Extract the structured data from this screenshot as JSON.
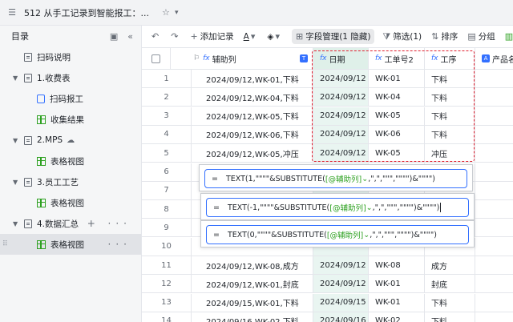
{
  "window": {
    "title": "512 从手工记录到智能报工：...",
    "menu_icon": "hamburger-icon",
    "star_icon": "star-icon"
  },
  "sidebar": {
    "header": "目录",
    "items": [
      {
        "label": "扫码说明",
        "icon": "doc-icon",
        "level": 0
      },
      {
        "label": "1.收费表",
        "icon": "doc-icon",
        "level": 0,
        "expandable": true
      },
      {
        "label": "扫码报工",
        "icon": "form-icon",
        "level": 1
      },
      {
        "label": "收集结果",
        "icon": "grid-icon",
        "level": 1
      },
      {
        "label": "2.MPS",
        "icon": "doc-icon",
        "level": 0,
        "expandable": true,
        "extra_icon": "cloud-icon"
      },
      {
        "label": "表格视图",
        "icon": "grid-icon",
        "level": 1
      },
      {
        "label": "3.员工工艺",
        "icon": "doc-icon",
        "level": 0,
        "expandable": true
      },
      {
        "label": "表格视图",
        "icon": "grid-icon",
        "level": 1
      },
      {
        "label": "4.数据汇总",
        "icon": "doc-icon",
        "level": 0,
        "expandable": true,
        "ops": "+ ···"
      },
      {
        "label": "表格视图",
        "icon": "grid-icon",
        "level": 1,
        "active": true,
        "ops": "···"
      }
    ]
  },
  "toolbar": {
    "undo": "↶",
    "redo": "↷",
    "add_record": "添加记录",
    "text_format": "A",
    "fill_color": "◈",
    "field_manage": "字段管理(1 隐藏)",
    "filter": "筛选(1)",
    "sort": "排序",
    "group": "分组"
  },
  "table": {
    "columns": {
      "aux": "辅助列",
      "date": "日期",
      "order_no": "工单号2",
      "process": "工序",
      "product": "产品名"
    },
    "rows": [
      {
        "n": "1",
        "aux": "2024/09/12,WK-01,下料",
        "date": "2024/09/12",
        "no": "WK-01",
        "proc": "下料"
      },
      {
        "n": "2",
        "aux": "2024/09/12,WK-04,下料",
        "date": "2024/09/12",
        "no": "WK-04",
        "proc": "下料"
      },
      {
        "n": "3",
        "aux": "2024/09/12,WK-05,下料",
        "date": "2024/09/12",
        "no": "WK-05",
        "proc": "下料"
      },
      {
        "n": "4",
        "aux": "2024/09/12,WK-06,下料",
        "date": "2024/09/12",
        "no": "WK-06",
        "proc": "下料"
      },
      {
        "n": "5",
        "aux": "2024/09/12,WK-05,冲压",
        "date": "2024/09/12",
        "no": "WK-05",
        "proc": "冲压"
      },
      {
        "n": "6",
        "aux": "",
        "date": "",
        "no": "",
        "proc": ""
      },
      {
        "n": "7",
        "aux": "",
        "date": "",
        "no": "",
        "proc": ""
      },
      {
        "n": "8",
        "aux": "",
        "date": "",
        "no": "",
        "proc": ""
      },
      {
        "n": "9",
        "aux": "",
        "date": "",
        "no": "",
        "proc": ""
      },
      {
        "n": "10",
        "aux": "",
        "date": "",
        "no": "",
        "proc": ""
      },
      {
        "n": "11",
        "aux": "2024/09/12,WK-08,成方",
        "date": "2024/09/12",
        "no": "WK-08",
        "proc": "成方"
      },
      {
        "n": "12",
        "aux": "2024/09/12,WK-01,封底",
        "date": "2024/09/12",
        "no": "WK-01",
        "proc": "封底"
      },
      {
        "n": "13",
        "aux": "2024/09/15,WK-01,下料",
        "date": "2024/09/15",
        "no": "WK-01",
        "proc": "下料"
      },
      {
        "n": "14",
        "aux": "2024/09/16,WK-02,下料",
        "date": "2024/09/16",
        "no": "WK-02",
        "proc": "下料"
      }
    ]
  },
  "formulas": [
    {
      "prefix": "=",
      "before": "TEXT(1,\"\"\"\"&SUBSTITUTE(",
      "ref": "[@辅助列]",
      "after": ",\",\",\"\"\",\"\"\"\")&\"\"\"\")"
    },
    {
      "prefix": "=",
      "before": "TEXT(-1,\"\"\"\"&SUBSTITUTE(",
      "ref": "[@辅助列]",
      "after": ",\",\",\"\"\",\"\"\"\")&\"\"\"\")"
    },
    {
      "prefix": "=",
      "before": "TEXT(0,\"\"\"\"&SUBSTITUTE(",
      "ref": "[@辅助列]",
      "after": ",\",\",\"\"\",\"\"\"\")&\"\"\"\")"
    }
  ],
  "colors": {
    "accent": "#3370ff",
    "highlight": "#e0202f",
    "date_column_bg": "#e9f5f1",
    "formula_ref": "#2ea121"
  }
}
